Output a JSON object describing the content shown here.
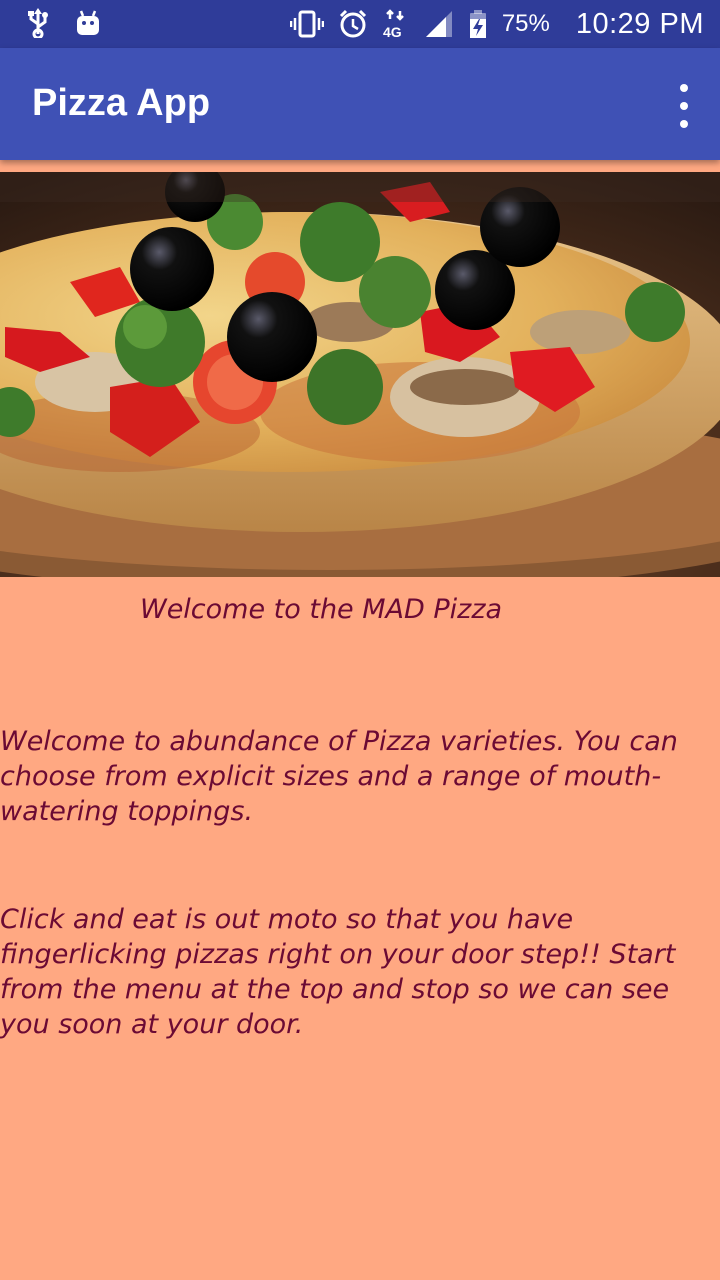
{
  "status_bar": {
    "icons_left": [
      "usb-icon",
      "android-icon"
    ],
    "icons_right": [
      "vibrate-icon",
      "alarm-icon",
      "network-4g-icon",
      "signal-icon",
      "battery-charging-icon"
    ],
    "battery": "75%",
    "time": "10:29 PM",
    "background": "#2F3C99"
  },
  "app_bar": {
    "title": "Pizza App",
    "menu_icon": "overflow-menu-icon",
    "background": "#3F51B5"
  },
  "hero": {
    "image": "pizza-photo"
  },
  "content": {
    "welcome": "Welcome to the MAD Pizza",
    "paragraph1": "Welcome to abundance of Pizza varieties. You can choose from explicit sizes and a range of mouth-watering toppings.",
    "paragraph2": "Click and eat is out moto so that you have fingerlicking pizzas right on your door step!! Start from the menu at the top and stop so we can see you soon at your door."
  },
  "colors": {
    "page_background": "#FFA882",
    "text": "#6B0A34"
  }
}
